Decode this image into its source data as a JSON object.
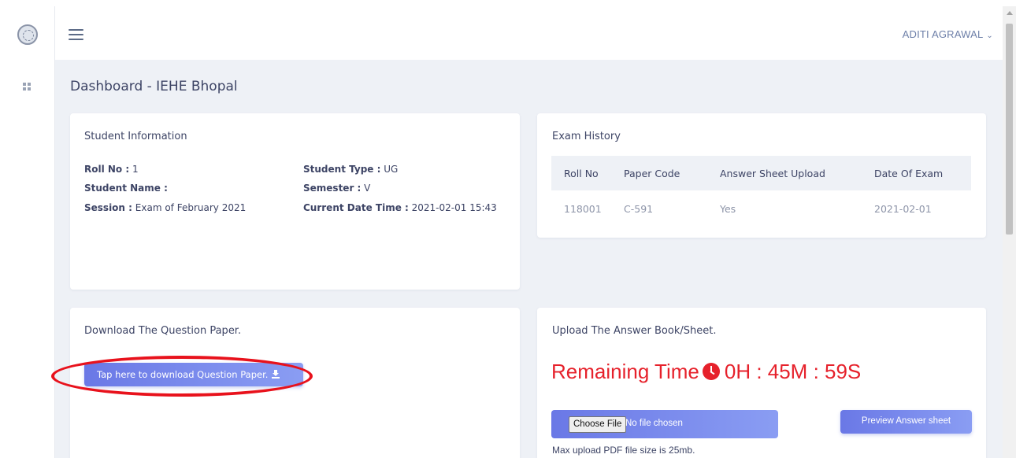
{
  "header": {
    "user_name": "ADITI AGRAWAL",
    "caret": "⌄"
  },
  "page": {
    "title": "Dashboard - IEHE Bhopal"
  },
  "student_info": {
    "title": "Student Information",
    "roll_no_label": "Roll No :",
    "roll_no_value": "1",
    "student_type_label": "Student Type :",
    "student_type_value": "UG",
    "student_name_label": "Student Name :",
    "student_name_value": "",
    "semester_label": "Semester :",
    "semester_value": "V",
    "session_label": "Session :",
    "session_value": "Exam of February 2021",
    "current_dt_label": "Current Date Time :",
    "current_dt_value": "2021-02-01 15:43"
  },
  "exam_history": {
    "title": "Exam History",
    "columns": [
      "Roll No",
      "Paper Code",
      "Answer Sheet Upload",
      "Date Of Exam"
    ],
    "rows": [
      [
        "118001",
        "C-591",
        "Yes",
        "2021-02-01"
      ]
    ]
  },
  "download": {
    "title": "Download The Question Paper.",
    "button_label": "Tap here to download Question Paper."
  },
  "upload": {
    "title": "Upload The Answer Book/Sheet.",
    "remaining_label": "Remaining Time",
    "remaining_value": "0H : 45M : 59S",
    "choose_file_label": "Choose File",
    "no_file_text": "No file chosen",
    "preview_label": "Preview Answer sheet",
    "max_upload_text": "Max upload PDF file size is 25mb."
  },
  "colors": {
    "accent": "#7383e8",
    "alert_red": "#e6212b",
    "background": "#eef1f6"
  },
  "icons": [
    "logo-emblem",
    "dashboard-grid-icon",
    "hamburger-menu-icon",
    "chevron-down-icon",
    "download-icon",
    "clock-icon"
  ]
}
